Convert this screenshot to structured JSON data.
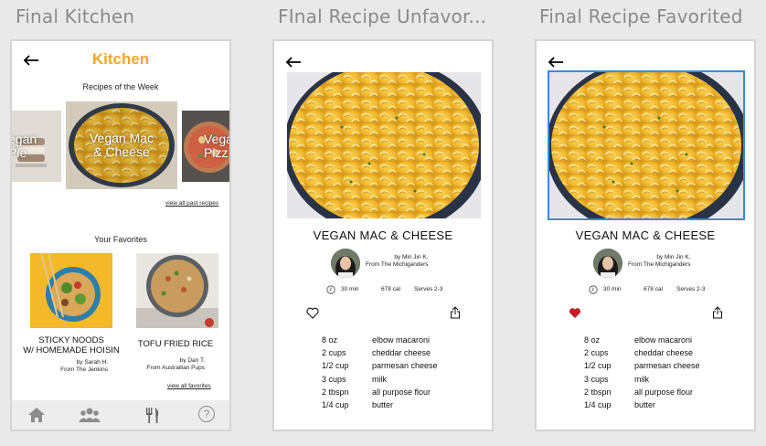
{
  "frame_titles": [
    "Final Kitchen",
    "FInal Recipe Unfavor...",
    "Final Recipe Favorited"
  ],
  "kitchen": {
    "title": "Kitchen",
    "recipes_of_week_label": "Recipes of the Week",
    "carousel": [
      {
        "text_line1": "egan",
        "text_line2": "Pie"
      },
      {
        "text_line1": "Vegan Mac",
        "text_line2": "& Cheese"
      },
      {
        "text_line1": "Vega",
        "text_line2": "Pizz"
      }
    ],
    "view_all_past": "view all past recipes",
    "your_favorites_label": "Your Favorites",
    "favorites": [
      {
        "title_line1": "STICKY NOODS",
        "title_line2": "W/ HOMEMADE HOISIN",
        "by": "by Sarah H.",
        "from": "From The Jenkins"
      },
      {
        "title_line1": "TOFU FRIED RICE",
        "title_line2": "",
        "by": "by Dan T.",
        "from": "From Austrailian Pups"
      }
    ],
    "view_all_favorites": "view all favorites",
    "tabs": [
      "home-icon",
      "people-icon",
      "utensils-icon",
      "help-icon"
    ],
    "help_glyph": "?"
  },
  "recipe": {
    "title": "VEGAN MAC & CHEESE",
    "author": "by Min Jin K.",
    "group": "From The Michiganders",
    "time": "30 min",
    "calories": "678 cal",
    "serves": "Serves 2-3",
    "ingredients": [
      {
        "qty": "8 oz",
        "name": "elbow macaroni"
      },
      {
        "qty": "2 cups",
        "name": "cheddar cheese"
      },
      {
        "qty": "1/2 cup",
        "name": "parmesan cheese"
      },
      {
        "qty": "3 cups",
        "name": "milk"
      },
      {
        "qty": "2 tbspn",
        "name": "all purpose flour"
      },
      {
        "qty": "1/4 cup",
        "name": "butter"
      }
    ]
  },
  "recipe_unfavorited": {
    "favorited": false
  },
  "recipe_favorited": {
    "favorited": true
  },
  "colors": {
    "accent": "#f5a623",
    "favorite_red": "#c81d25",
    "selection_blue": "#2d8fe2",
    "frame_title": "#8a8a8a"
  }
}
